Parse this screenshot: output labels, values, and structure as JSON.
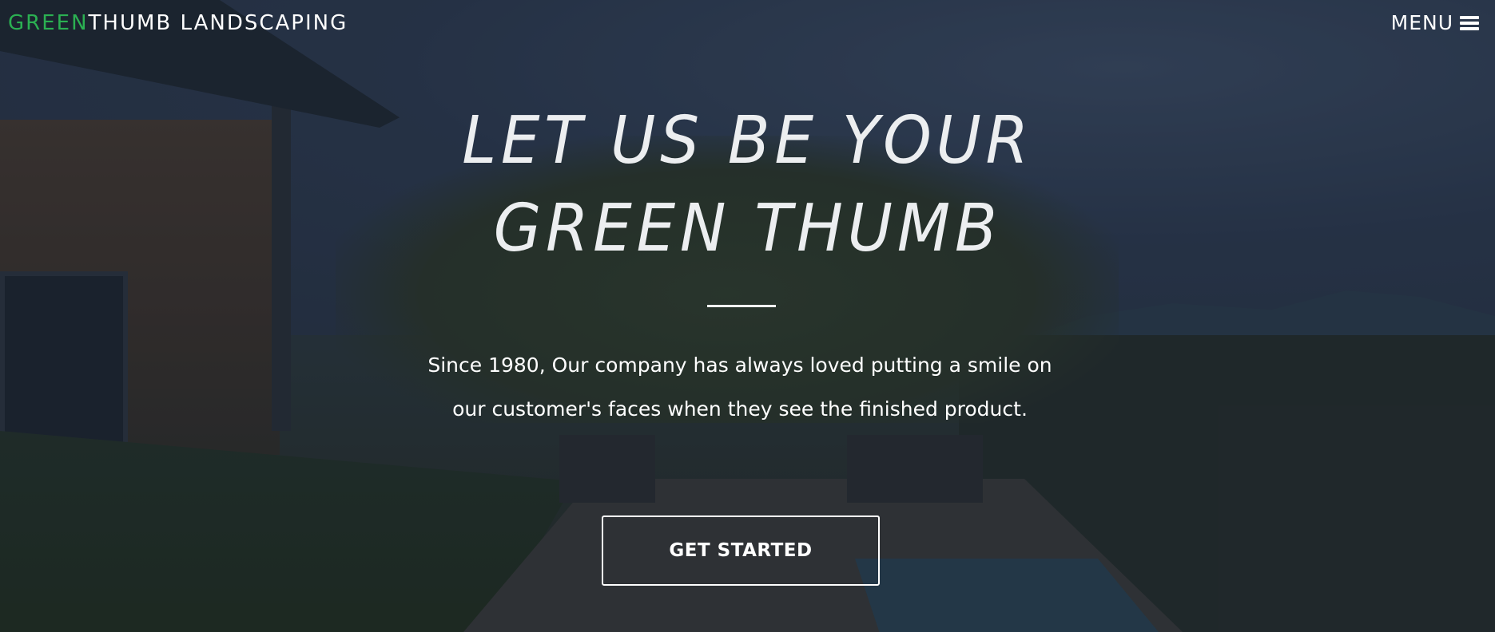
{
  "navbar": {
    "brand_green": "GREEN",
    "brand_rest": "THUMB LANDSCAPING",
    "menu_label": "MENU",
    "menu_icon": "hamburger-icon"
  },
  "hero": {
    "headline_line1": "LET US BE YOUR",
    "headline_line2": "GREEN THUMB",
    "description": "Since 1980, Our company has always loved putting a smile on our customer's faces when they see the finished product.",
    "cta_label": "GET STARTED",
    "background_image": "backyard-patio-pool-photo"
  },
  "colors": {
    "brand_accent": "#2bb052",
    "text": "#ffffff",
    "overlay": "#141c28"
  }
}
